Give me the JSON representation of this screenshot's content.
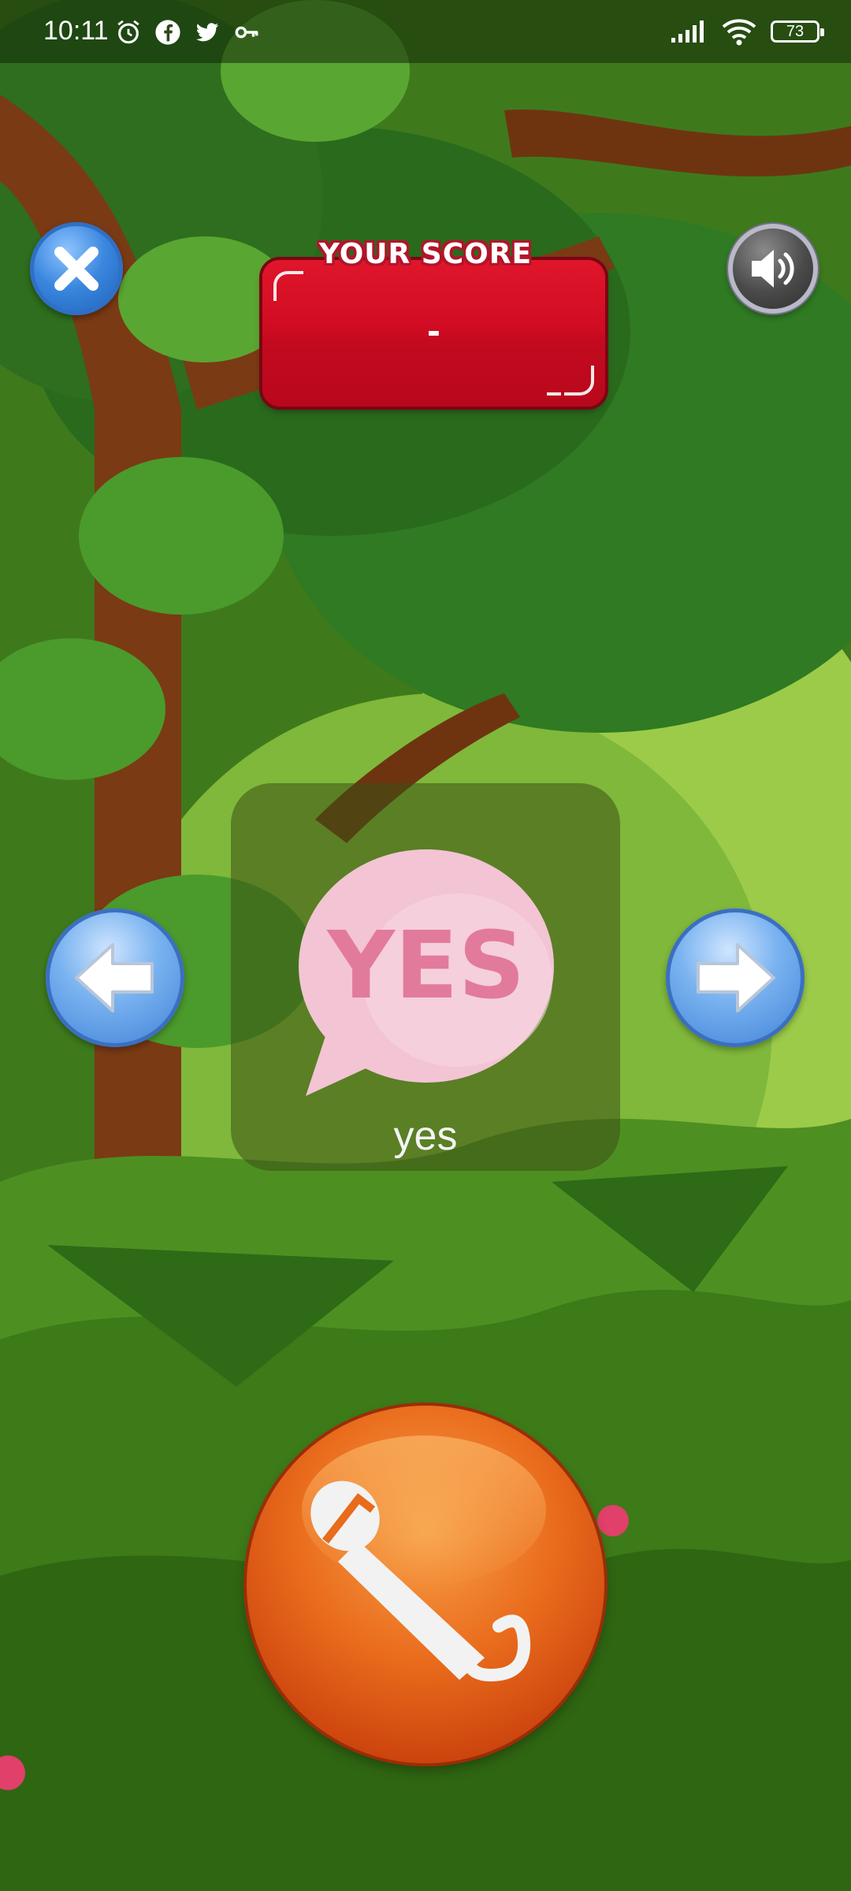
{
  "status_bar": {
    "time": "10:11",
    "battery": "73",
    "left_icons": [
      "alarm-icon",
      "facebook-icon",
      "twitter-icon",
      "key-icon"
    ],
    "right_icons": [
      "signal-icon",
      "wifi-icon",
      "battery-icon"
    ]
  },
  "score": {
    "title": "YOUR SCORE",
    "value": "-"
  },
  "card": {
    "image_text": "YES",
    "word": "yes"
  },
  "buttons": {
    "close": "close-icon",
    "sound": "speaker-icon",
    "previous": "arrow-left-icon",
    "next": "arrow-right-icon",
    "record": "microphone-icon"
  },
  "colors": {
    "score_panel": "#d10c22",
    "card_bubble": "#f3c4d3",
    "card_text": "#e27a9c",
    "mic_button": "#e96b1c",
    "nav_button": "#5a98e6"
  }
}
